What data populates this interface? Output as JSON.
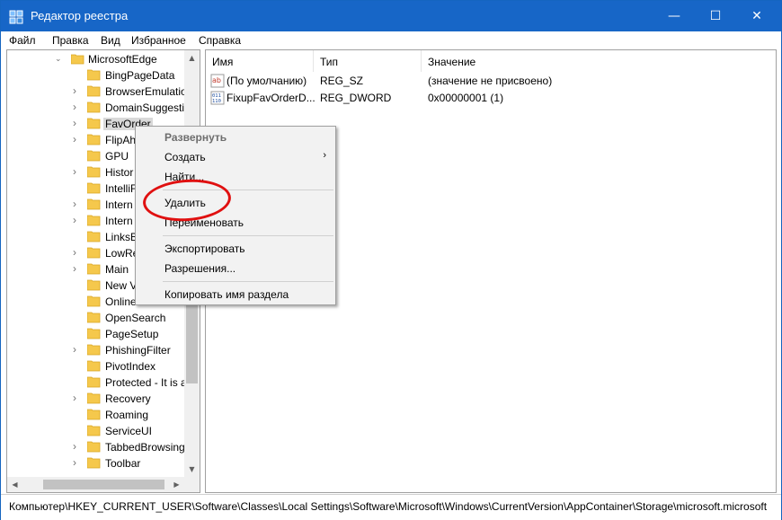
{
  "window": {
    "title": "Редактор реестра",
    "minimize_glyph": "—",
    "maximize_glyph": "☐",
    "close_glyph": "✕"
  },
  "menu": [
    "Файл",
    "Правка",
    "Вид",
    "Избранное",
    "Справка"
  ],
  "tree": {
    "parent": "MicrosoftEdge",
    "items": [
      {
        "label": "BingPageData",
        "expandable": false
      },
      {
        "label": "BrowserEmulatio",
        "expandable": true
      },
      {
        "label": "DomainSuggesti",
        "expandable": true
      },
      {
        "label": "FavOrder",
        "expandable": true,
        "selected": true
      },
      {
        "label": "FlipAh",
        "expandable": true
      },
      {
        "label": "GPU",
        "expandable": false
      },
      {
        "label": "Histor",
        "expandable": true
      },
      {
        "label": "IntelliF",
        "expandable": false
      },
      {
        "label": "Intern",
        "expandable": true
      },
      {
        "label": "Intern",
        "expandable": true
      },
      {
        "label": "LinksB",
        "expandable": false
      },
      {
        "label": "LowRe",
        "expandable": true
      },
      {
        "label": "Main",
        "expandable": true
      },
      {
        "label": "New V",
        "expandable": false
      },
      {
        "label": "Online",
        "expandable": false
      },
      {
        "label": "OpenSearch",
        "expandable": false
      },
      {
        "label": "PageSetup",
        "expandable": false
      },
      {
        "label": "PhishingFilter",
        "expandable": true
      },
      {
        "label": "PivotIndex",
        "expandable": false
      },
      {
        "label": "Protected - It is a",
        "expandable": false
      },
      {
        "label": "Recovery",
        "expandable": true
      },
      {
        "label": "Roaming",
        "expandable": false
      },
      {
        "label": "ServiceUI",
        "expandable": false
      },
      {
        "label": "TabbedBrowsing",
        "expandable": true
      },
      {
        "label": "Toolbar",
        "expandable": true
      }
    ]
  },
  "list": {
    "columns": [
      "Имя",
      "Тип",
      "Значение"
    ],
    "rows": [
      {
        "name": "(По умолчанию)",
        "type": "REG_SZ",
        "value": "(значение не присвоено)",
        "icon": "string-value-icon"
      },
      {
        "name": "FixupFavOrderD...",
        "type": "REG_DWORD",
        "value": "0x00000001 (1)",
        "icon": "binary-value-icon"
      }
    ]
  },
  "context_menu": {
    "expand": "Развернуть",
    "create": "Создать",
    "find": "Найти...",
    "delete": "Удалить",
    "rename": "Переименовать",
    "export": "Экспортировать",
    "permissions": "Разрешения...",
    "copy_key_name": "Копировать имя раздела"
  },
  "statusbar": "Компьютер\\HKEY_CURRENT_USER\\Software\\Classes\\Local Settings\\Software\\Microsoft\\Windows\\CurrentVersion\\AppContainer\\Storage\\microsoft.microsoft",
  "colors": {
    "titlebar": "#1766c7",
    "highlight_circle": "#e01010",
    "folder": "#f5c84c"
  }
}
